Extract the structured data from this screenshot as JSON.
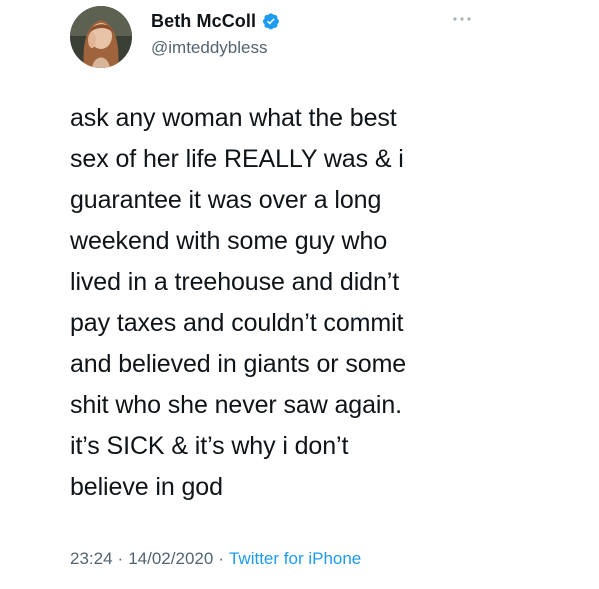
{
  "author": {
    "display_name": "Beth McColl",
    "handle": "@imteddybless",
    "verified": true,
    "avatar_icon": "profile-photo"
  },
  "tweet": {
    "text": "ask any woman what the best\nsex of her life REALLY was & i\nguarantee it was over a long\nweekend with some guy who\nlived in a treehouse and didn’t\npay taxes and couldn’t commit\nand believed in giants or some\nshit who she never saw again.\nit’s SICK & it’s why i don’t\nbelieve in god",
    "time": "23:24",
    "date": "14/02/2020",
    "separator": "·",
    "source": "Twitter for iPhone"
  },
  "icons": {
    "verified": "verified-badge-icon",
    "more": "more-options-icon"
  },
  "colors": {
    "text": "#0f1419",
    "secondary": "#536471",
    "accent": "#1d9bf0",
    "background": "#ffffff"
  }
}
